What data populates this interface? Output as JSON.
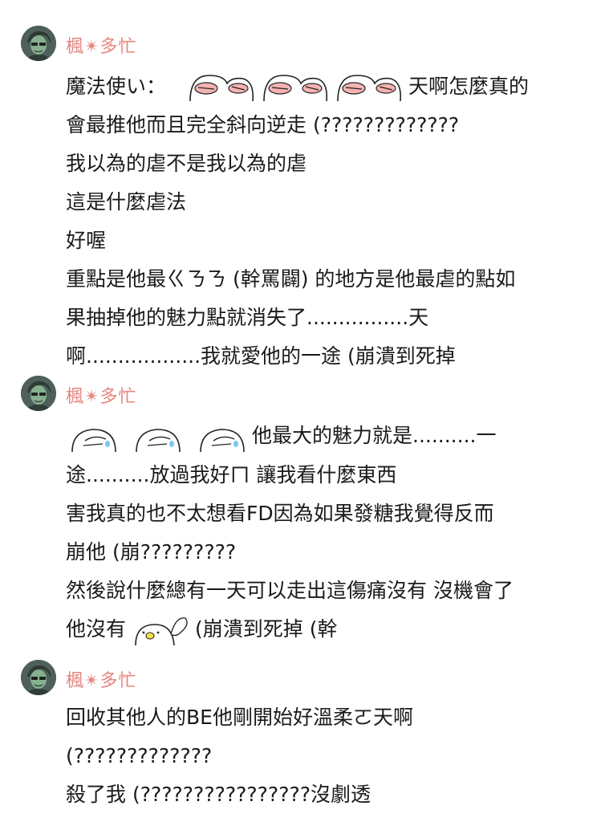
{
  "posts": [
    {
      "username": "楓✴多忙",
      "lines": [
        {
          "pre": "魔法使い：",
          "stickers": [
            "pig-blush-sticker",
            "pig-blush-sticker",
            "pig-blush-sticker"
          ],
          "post": "天啊怎麼真的"
        },
        {
          "text": "會最推他而且完全斜向逆走 (?????????????"
        },
        {
          "text": "我以為的虐不是我以為的虐"
        },
        {
          "text": "這是什麼虐法"
        },
        {
          "text": "好喔"
        },
        {
          "text": "重點是他最ㄍㄋㄋ (幹罵闢) 的地方是他最虐的點如"
        },
        {
          "text": "果抽掉他的魅力點就消失了................天"
        },
        {
          "text": "啊..................我就愛他的一途 (崩潰到死掉"
        }
      ]
    },
    {
      "username": "楓✴多忙",
      "lines": [
        {
          "pre": "",
          "stickers": [
            "blob-crying-sticker",
            "blob-crying-sticker",
            "blob-crying-sticker"
          ],
          "post": "他最大的魅力就是..........一"
        },
        {
          "text": "途..........放過我好ㄇ 讓我看什麼東西"
        },
        {
          "text": "害我真的也不太想看FD因為如果發糖我覺得反而"
        },
        {
          "text": "崩他 (崩?????????"
        },
        {
          "text": "然後說什麼總有一天可以走出這傷痛沒有 沒機會了"
        },
        {
          "pre": "他沒有",
          "stickers": [
            "blob-soul-sticker"
          ],
          "post": "(崩潰到死掉 (幹"
        }
      ]
    },
    {
      "username": "楓✴多忙",
      "lines": [
        {
          "text": "回收其他人的BE他剛開始好溫柔ㄛ天啊"
        },
        {
          "text": "(?????????????"
        },
        {
          "text": "殺了我 (????????????????沒劇透"
        }
      ]
    }
  ]
}
